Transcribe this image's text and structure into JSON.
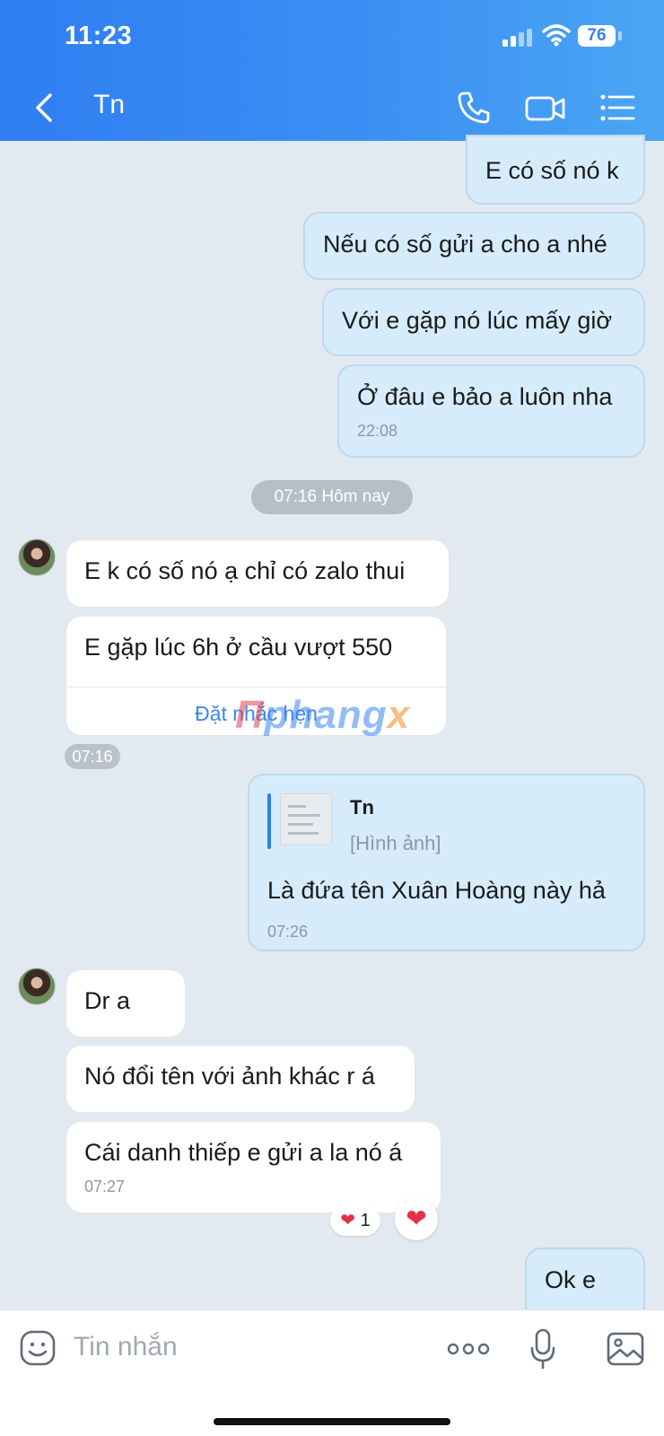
{
  "status_bar": {
    "time": "11:23",
    "battery": "76"
  },
  "header": {
    "title": "Tn"
  },
  "messages": {
    "m1": {
      "text": "E có số nó k"
    },
    "m2": {
      "text": "Nếu có số gửi a cho a nhé"
    },
    "m3": {
      "text": "Với e gặp nó lúc mấy giờ"
    },
    "m4": {
      "text": "Ở đâu e bảo a luôn nha",
      "time": "22:08"
    },
    "day_separator": "07:16 Hôm nay",
    "m5": {
      "text": "E k có số nó ạ chỉ có zalo thui"
    },
    "m6": {
      "text": "E gặp lúc 6h  ở  cầu vượt 550",
      "action": "Đặt nhắc hẹn"
    },
    "m6_time": "07:16",
    "m7": {
      "quote_name": "Tn",
      "quote_sub": "[Hình ảnh]",
      "text": "Là đứa tên Xuân Hoàng này hả",
      "time": "07:26"
    },
    "m8": {
      "text": "Dr a"
    },
    "m9": {
      "text": "Nó đổi tên với ảnh khác r á"
    },
    "m10": {
      "text": "Cái danh thiếp e gửi a la nó á",
      "time": "07:27"
    },
    "reaction": {
      "icon": "❤",
      "count": "1"
    },
    "m11": {
      "text": "Ok e"
    }
  },
  "watermark": {
    "part1": "Π",
    "part2": "phang",
    "part3": "x"
  },
  "input": {
    "placeholder": "Tin nhắn"
  },
  "colors": {
    "header_start": "#2f7ef2",
    "header_end": "#4aa6f4",
    "outgoing_bubble": "#d6ecfb",
    "incoming_bubble": "#ffffff",
    "chat_bg": "#e2e9f1",
    "link": "#3a86f0",
    "heart": "#e53146"
  }
}
